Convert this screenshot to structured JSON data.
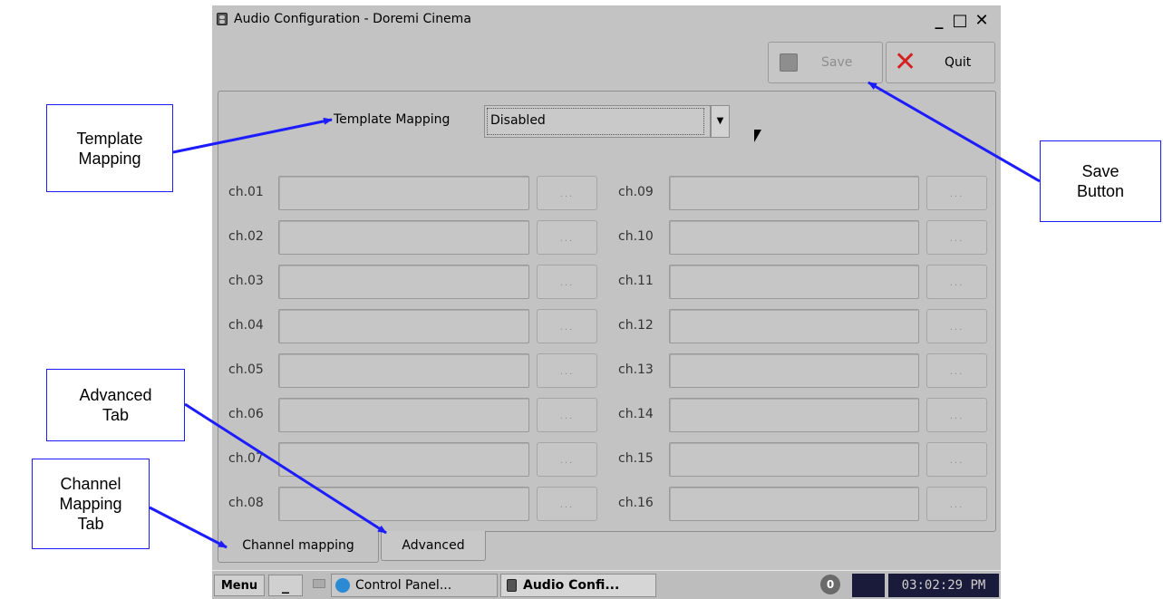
{
  "window": {
    "title": "Audio Configuration - Doremi Cinema",
    "minimize": "_",
    "maximize": "□",
    "close": "✕"
  },
  "toolbar": {
    "save_label": "Save",
    "quit_label": "Quit"
  },
  "template": {
    "label": "Template Mapping",
    "value": "Disabled"
  },
  "channels_left": [
    "ch.01",
    "ch.02",
    "ch.03",
    "ch.04",
    "ch.05",
    "ch.06",
    "ch.07",
    "ch.08"
  ],
  "channels_right": [
    "ch.09",
    "ch.10",
    "ch.11",
    "ch.12",
    "ch.13",
    "ch.14",
    "ch.15",
    "ch.16"
  ],
  "browse_label": "...",
  "tabs": [
    {
      "label": "Channel mapping",
      "active": true
    },
    {
      "label": "Advanced",
      "active": false
    }
  ],
  "taskbar": {
    "menu": "Menu",
    "minimize": "_",
    "tasks": [
      "Control Panel...",
      "Audio Confi..."
    ],
    "notify": "0",
    "clock": "03:02:29 PM"
  },
  "callouts": {
    "template": [
      "Template",
      "Mapping"
    ],
    "save": [
      "Save",
      "Button"
    ],
    "advanced": [
      "Advanced",
      "Tab"
    ],
    "channel": [
      "Channel",
      "Mapping",
      "Tab"
    ]
  },
  "colors": {
    "callout_border": "#1c1cff",
    "arrow": "#1c1cff",
    "quit_icon": "#d42020",
    "window_bg": "#c3c3c3"
  }
}
